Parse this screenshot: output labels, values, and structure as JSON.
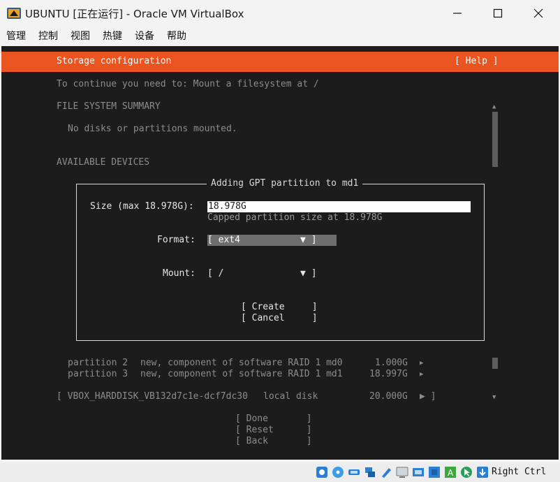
{
  "window": {
    "title": "UBUNTU [正在运行] - Oracle VM VirtualBox",
    "minimize_icon": "minimize-icon",
    "maximize_icon": "maximize-icon",
    "close_icon": "close-icon"
  },
  "menu": {
    "items": [
      "管理",
      "控制",
      "视图",
      "热键",
      "设备",
      "帮助"
    ]
  },
  "installer": {
    "header": "Storage configuration",
    "help": "[ Help ]",
    "instruction": "To continue you need to: Mount a filesystem at /",
    "fs_summary_heading": "FILE SYSTEM SUMMARY",
    "fs_summary_empty": "No disks or partitions mounted.",
    "available_heading": "AVAILABLE DEVICES",
    "dialog": {
      "title": "Adding GPT partition to md1",
      "size_label": "Size (max 18.978G):",
      "size_value": "18.978G",
      "size_note": "Capped partition size at 18.978G",
      "format_label": "Format:",
      "format_value": "[ ext4           ▼ ]",
      "mount_label": "Mount:",
      "mount_value": "[ /              ▼ ]",
      "create_button": "[ Create     ]",
      "cancel_button": "[ Cancel     ]"
    },
    "partitions": [
      {
        "name": "partition 2",
        "desc": "new, component of software RAID 1 md0",
        "size": "1.000G",
        "arrow": "▶"
      },
      {
        "name": "partition 3",
        "desc": "new, component of software RAID 1 md1",
        "size": "18.997G",
        "arrow": "▶"
      }
    ],
    "disk": {
      "name": "[ VBOX_HARDDISK_VB132d7c1e-dcf7dc30",
      "type": "local disk",
      "size": "20.000G",
      "arrow": "▶ ]"
    },
    "scroll_down_arrow": "▼",
    "scroll_up_arrow": "▲",
    "footer": {
      "done": "[ Done       ]",
      "reset": "[ Reset      ]",
      "back": "[ Back       ]"
    }
  },
  "statusbar": {
    "host_key": "Right Ctrl",
    "icons": [
      "hard-disk-icon",
      "optical-drive-icon",
      "usb-icon",
      "network-icon",
      "shared-folder-icon",
      "display-icon",
      "video-capture-icon",
      "recording-icon",
      "cpu-icon",
      "mouse-integration-icon",
      "keyboard-capture-icon"
    ]
  },
  "colors": {
    "accent": "#e95420",
    "terminal_bg": "#1c1c1c",
    "terminal_text": "#a8a8a8"
  }
}
